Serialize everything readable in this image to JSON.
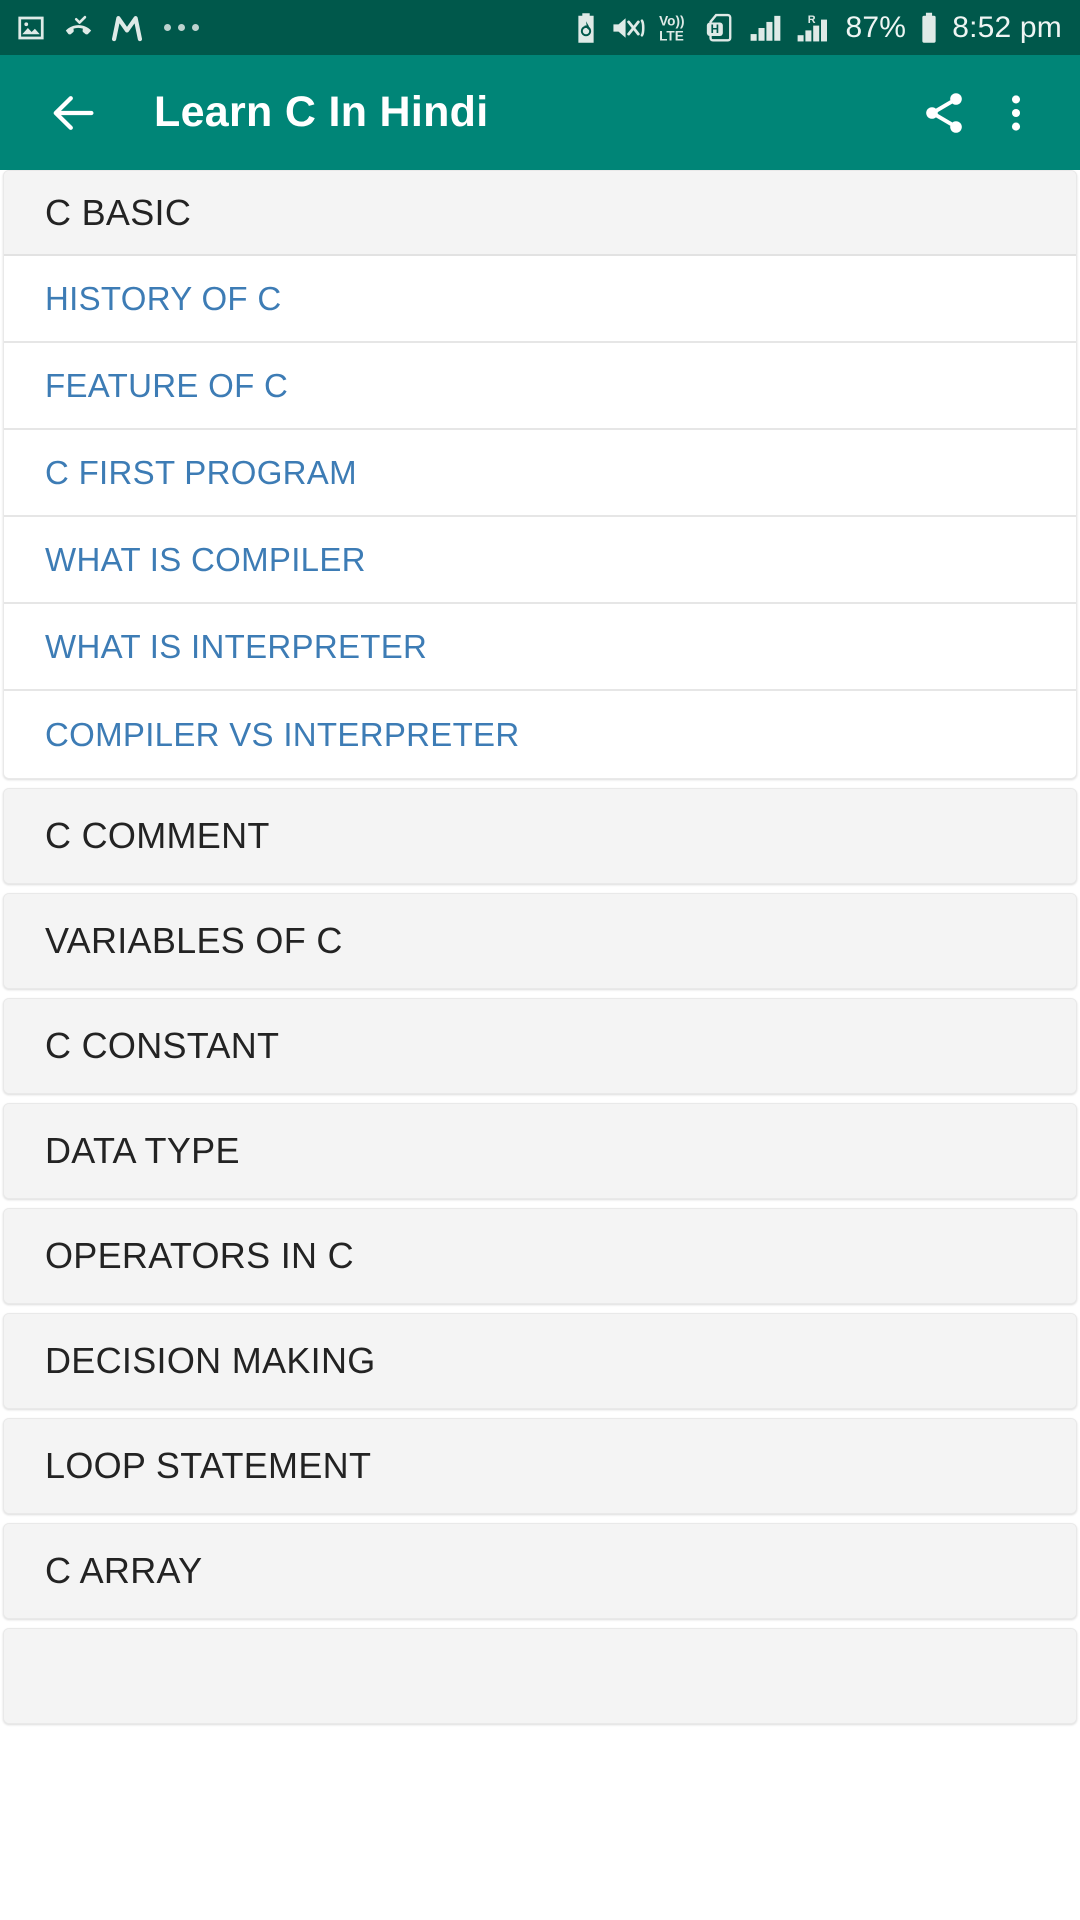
{
  "status_bar": {
    "background_color": "#00584b",
    "left_icons": [
      "image-screenshot-icon",
      "missed-call-icon",
      "m-app-icon",
      "more-dots-icon"
    ],
    "right_icons": [
      "battery-saver-icon",
      "mute-vibrate-icon",
      "volte-icon",
      "sim-h-icon",
      "signal-bars-icon",
      "signal-roaming-icon",
      "battery-icon"
    ],
    "volte_label_top": "Vo))",
    "volte_label_bottom": "LTE",
    "sim_letter": "H",
    "roaming_letter": "R",
    "battery_percent": "87%",
    "time": "8:52 pm"
  },
  "app_bar": {
    "background_color": "#008577",
    "back_icon": "arrow-back-icon",
    "title": "Learn C In Hindi",
    "share_icon": "share-icon",
    "overflow_icon": "more-vertical-icon"
  },
  "list": {
    "group_text_color": "#232323",
    "child_text_color": "#3d7cb5",
    "card_background": "#f4f4f4",
    "child_background": "#ffffff",
    "groups": [
      {
        "label": "C BASIC",
        "expanded": true,
        "children": [
          {
            "label": "HISTORY OF C"
          },
          {
            "label": "FEATURE OF C"
          },
          {
            "label": "C FIRST PROGRAM"
          },
          {
            "label": "WHAT IS COMPILER"
          },
          {
            "label": "WHAT IS INTERPRETER"
          },
          {
            "label": "COMPILER VS INTERPRETER"
          }
        ]
      },
      {
        "label": "C COMMENT",
        "expanded": false,
        "children": []
      },
      {
        "label": "VARIABLES OF C",
        "expanded": false,
        "children": []
      },
      {
        "label": "C CONSTANT",
        "expanded": false,
        "children": []
      },
      {
        "label": "DATA TYPE",
        "expanded": false,
        "children": []
      },
      {
        "label": "OPERATORS IN C",
        "expanded": false,
        "children": []
      },
      {
        "label": "DECISION MAKING",
        "expanded": false,
        "children": []
      },
      {
        "label": "LOOP STATEMENT",
        "expanded": false,
        "children": []
      },
      {
        "label": "C ARRAY",
        "expanded": false,
        "children": []
      },
      {
        "label": "",
        "expanded": false,
        "children": []
      }
    ]
  }
}
